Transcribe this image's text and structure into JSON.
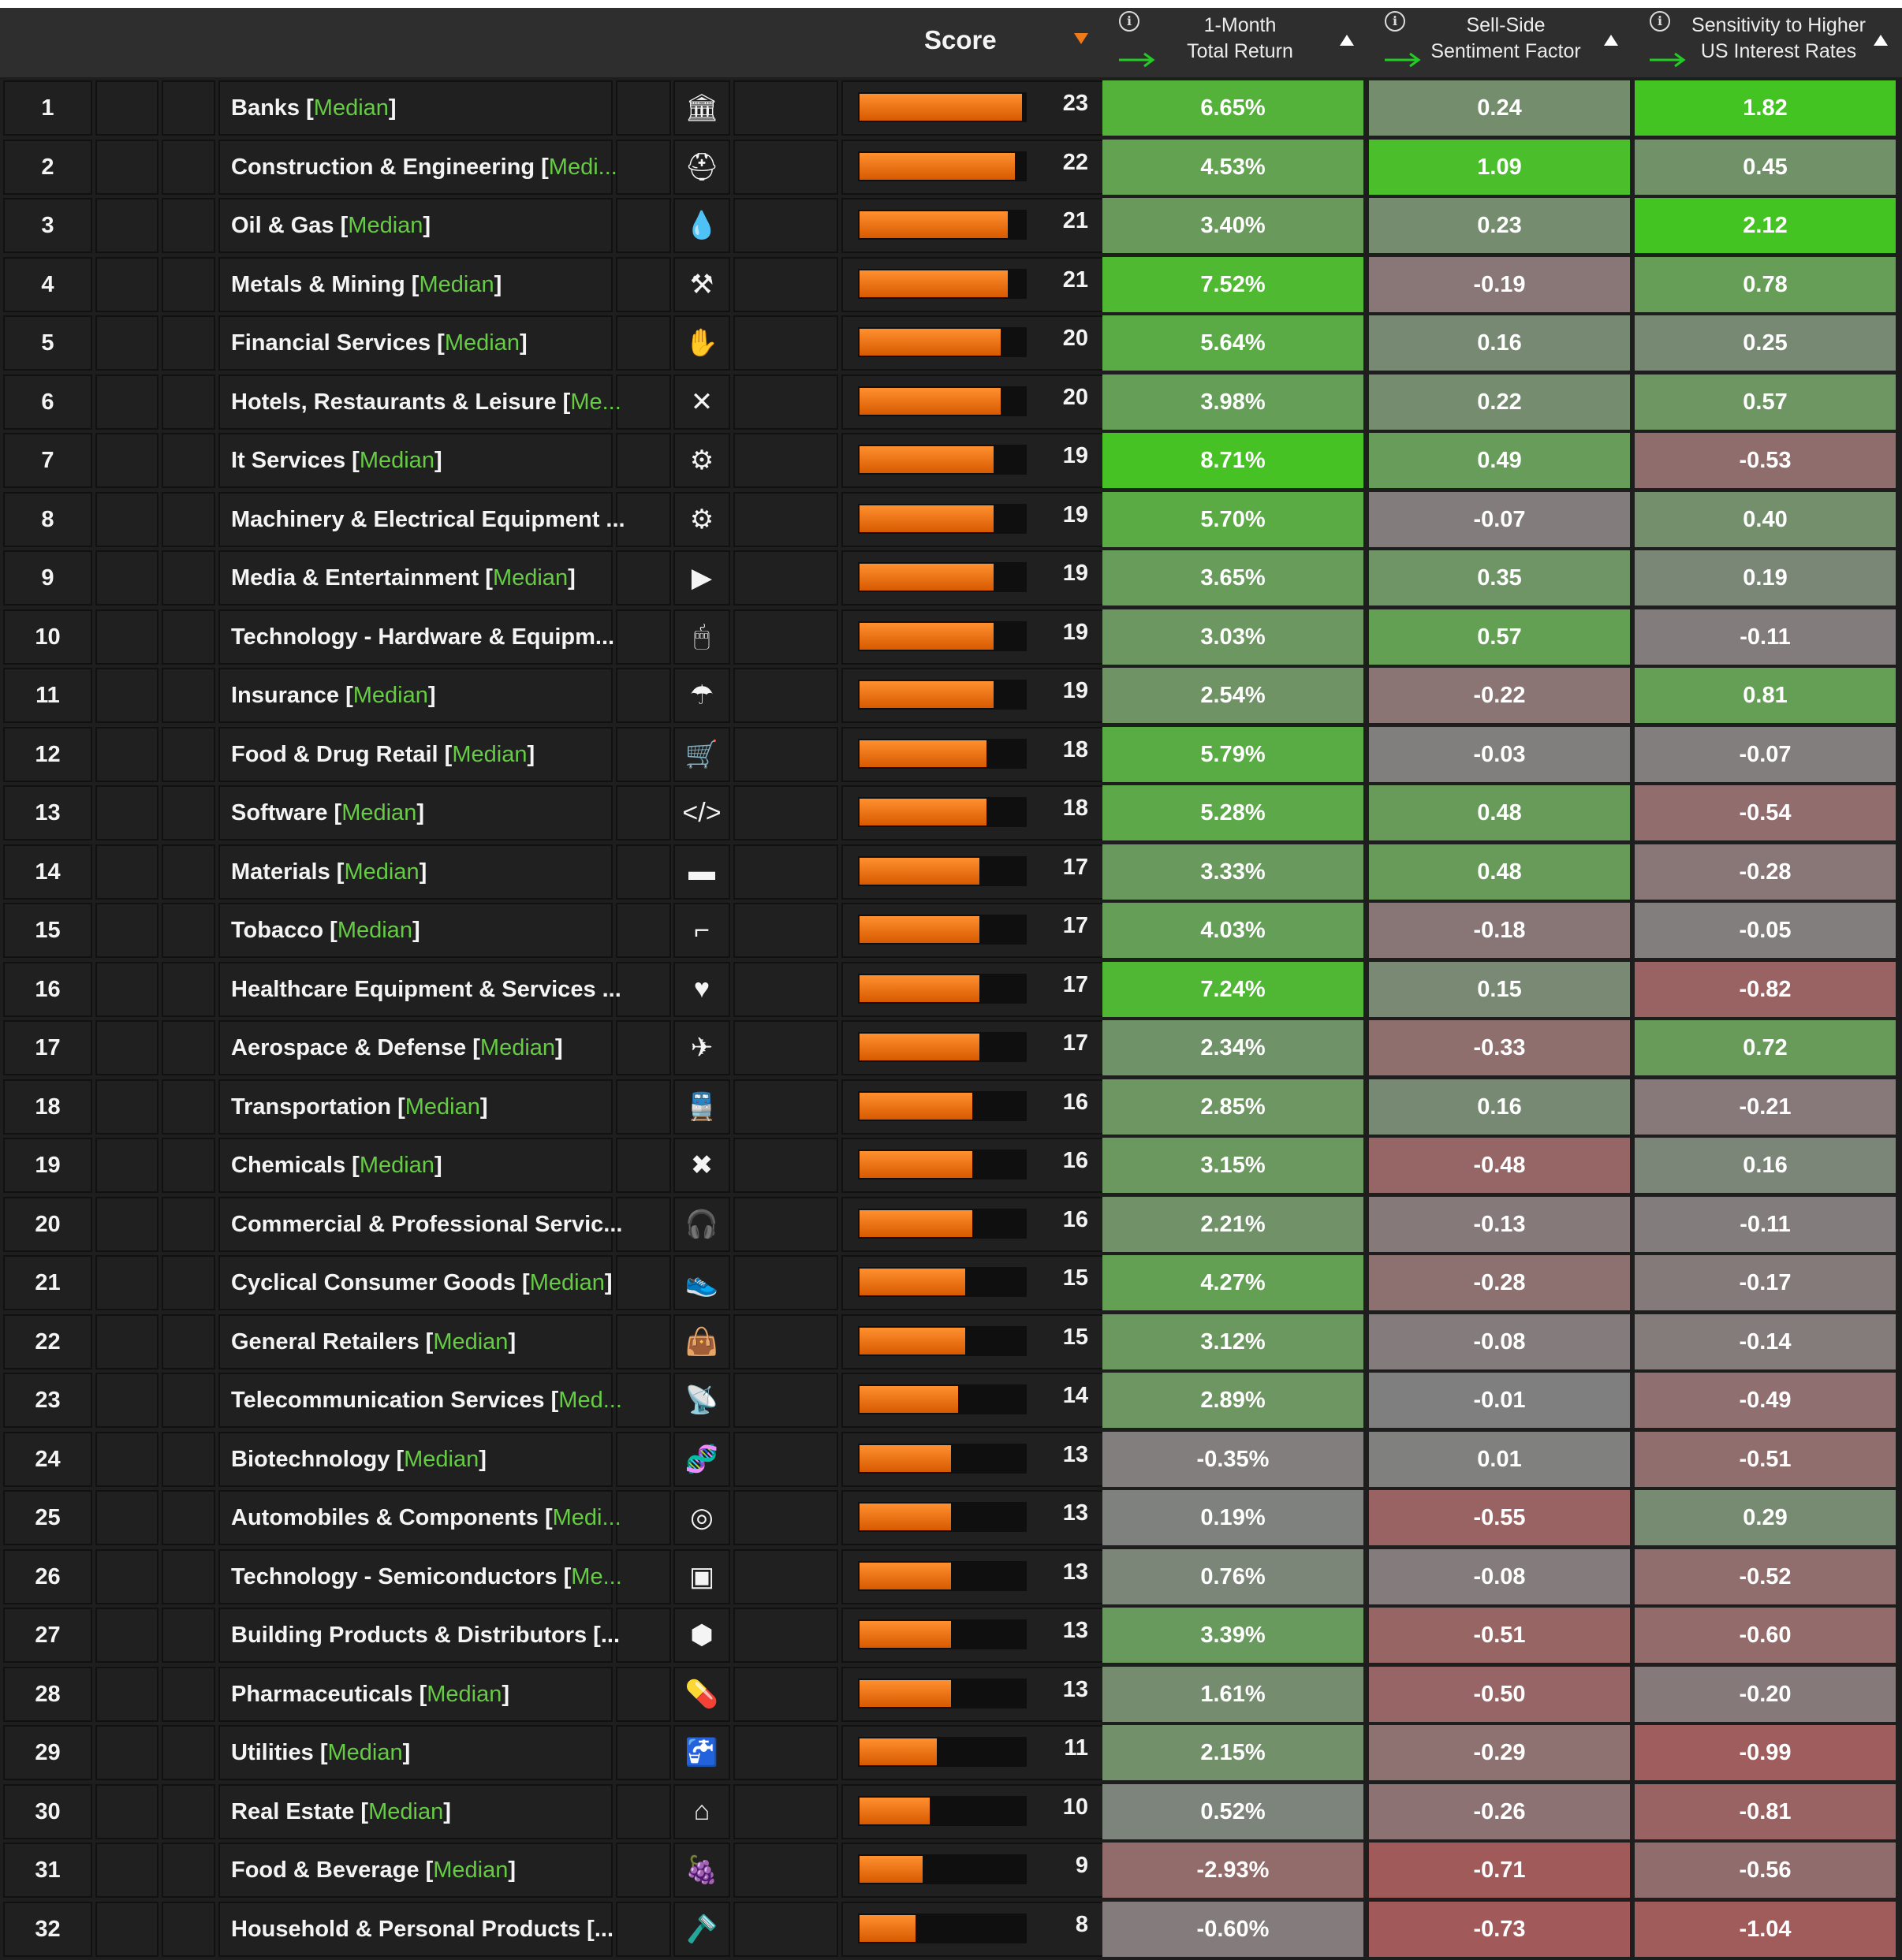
{
  "header": {
    "score_label": "Score",
    "columns": [
      {
        "line1": "1-Month",
        "line2": "Total Return"
      },
      {
        "line1": "Sell-Side",
        "line2": "Sentiment Factor"
      },
      {
        "line1": "Sensitivity to Higher",
        "line2": "US Interest Rates"
      }
    ],
    "info_icon": "info-circle-icon",
    "direction_icon": "green-arrow-right-icon"
  },
  "colors": {
    "bar": "#ee7a1a",
    "median_tag": "#66cc44",
    "positive": "#4ab82a",
    "neutral": "#808080",
    "negative": "#b84444"
  },
  "rows": [
    {
      "rank": "1",
      "name": "Banks ",
      "tag": "Median",
      "trunc": false,
      "icon": "bank-icon",
      "glyph": "🏛",
      "score": 23,
      "ret": "6.65%",
      "sent": "0.24",
      "rate": "1.82"
    },
    {
      "rank": "2",
      "name": "Construction & Engineering ",
      "tag": "Medi...",
      "trunc": true,
      "icon": "hard-hat-icon",
      "glyph": "⛑",
      "score": 22,
      "ret": "4.53%",
      "sent": "1.09",
      "rate": "0.45"
    },
    {
      "rank": "3",
      "name": "Oil & Gas ",
      "tag": "Median",
      "trunc": false,
      "icon": "oil-drop-icon",
      "glyph": "💧",
      "score": 21,
      "ret": "3.40%",
      "sent": "0.23",
      "rate": "2.12"
    },
    {
      "rank": "4",
      "name": "Metals & Mining ",
      "tag": "Median",
      "trunc": false,
      "icon": "pickaxe-icon",
      "glyph": "⚒",
      "score": 21,
      "ret": "7.52%",
      "sent": "-0.19",
      "rate": "0.78"
    },
    {
      "rank": "5",
      "name": "Financial Services ",
      "tag": "Median",
      "trunc": false,
      "icon": "hand-coins-icon",
      "glyph": "✋",
      "score": 20,
      "ret": "5.64%",
      "sent": "0.16",
      "rate": "0.25"
    },
    {
      "rank": "6",
      "name": "Hotels, Restaurants & Leisure ",
      "tag": "Me...",
      "trunc": true,
      "icon": "fork-knife-icon",
      "glyph": "✕",
      "score": 20,
      "ret": "3.98%",
      "sent": "0.22",
      "rate": "0.57"
    },
    {
      "rank": "7",
      "name": "It Services ",
      "tag": "Median",
      "trunc": false,
      "icon": "user-support-icon",
      "glyph": "⚙",
      "score": 19,
      "ret": "8.71%",
      "sent": "0.49",
      "rate": "-0.53"
    },
    {
      "rank": "8",
      "name": "Machinery & Electrical Equipment ...",
      "tag": "",
      "trunc": false,
      "icon": "gear-icon",
      "glyph": "⚙",
      "score": 19,
      "ret": "5.70%",
      "sent": "-0.07",
      "rate": "0.40"
    },
    {
      "rank": "9",
      "name": "Media & Entertainment ",
      "tag": "Median",
      "trunc": false,
      "icon": "play-circle-icon",
      "glyph": "▶",
      "score": 19,
      "ret": "3.65%",
      "sent": "0.35",
      "rate": "0.19"
    },
    {
      "rank": "10",
      "name": "Technology - Hardware & Equipm...",
      "tag": "",
      "trunc": false,
      "icon": "mouse-icon",
      "glyph": "🖱",
      "score": 19,
      "ret": "3.03%",
      "sent": "0.57",
      "rate": "-0.11"
    },
    {
      "rank": "11",
      "name": "Insurance ",
      "tag": "Median",
      "trunc": false,
      "icon": "umbrella-icon",
      "glyph": "☂",
      "score": 19,
      "ret": "2.54%",
      "sent": "-0.22",
      "rate": "0.81"
    },
    {
      "rank": "12",
      "name": "Food & Drug Retail ",
      "tag": "Median",
      "trunc": false,
      "icon": "shopping-cart-icon",
      "glyph": "🛒",
      "score": 18,
      "ret": "5.79%",
      "sent": "-0.03",
      "rate": "-0.07"
    },
    {
      "rank": "13",
      "name": "Software ",
      "tag": "Median",
      "trunc": false,
      "icon": "code-icon",
      "glyph": "</>",
      "score": 18,
      "ret": "5.28%",
      "sent": "0.48",
      "rate": "-0.54"
    },
    {
      "rank": "14",
      "name": "Materials ",
      "tag": "Median",
      "trunc": false,
      "icon": "materials-icon",
      "glyph": "▬",
      "score": 17,
      "ret": "3.33%",
      "sent": "0.48",
      "rate": "-0.28"
    },
    {
      "rank": "15",
      "name": "Tobacco ",
      "tag": "Median",
      "trunc": false,
      "icon": "pipe-icon",
      "glyph": "⌐",
      "score": 17,
      "ret": "4.03%",
      "sent": "-0.18",
      "rate": "-0.05"
    },
    {
      "rank": "16",
      "name": "Healthcare Equipment & Services ...",
      "tag": "",
      "trunc": false,
      "icon": "heart-plus-icon",
      "glyph": "♥",
      "score": 17,
      "ret": "7.24%",
      "sent": "0.15",
      "rate": "-0.82"
    },
    {
      "rank": "17",
      "name": "Aerospace & Defense ",
      "tag": "Median",
      "trunc": false,
      "icon": "airplane-icon",
      "glyph": "✈",
      "score": 17,
      "ret": "2.34%",
      "sent": "-0.33",
      "rate": "0.72"
    },
    {
      "rank": "18",
      "name": "Transportation ",
      "tag": "Median",
      "trunc": false,
      "icon": "train-icon",
      "glyph": "🚆",
      "score": 16,
      "ret": "2.85%",
      "sent": "0.16",
      "rate": "-0.21"
    },
    {
      "rank": "19",
      "name": "Chemicals ",
      "tag": "Median",
      "trunc": false,
      "icon": "chemicals-icon",
      "glyph": "✖",
      "score": 16,
      "ret": "3.15%",
      "sent": "-0.48",
      "rate": "0.16"
    },
    {
      "rank": "20",
      "name": "Commercial & Professional Servic...",
      "tag": "",
      "trunc": false,
      "icon": "headphones-icon",
      "glyph": "🎧",
      "score": 16,
      "ret": "2.21%",
      "sent": "-0.13",
      "rate": "-0.11"
    },
    {
      "rank": "21",
      "name": "Cyclical Consumer Goods ",
      "tag": "Median",
      "trunc": false,
      "icon": "shoe-icon",
      "glyph": "👟",
      "score": 15,
      "ret": "4.27%",
      "sent": "-0.28",
      "rate": "-0.17"
    },
    {
      "rank": "22",
      "name": "General Retailers ",
      "tag": "Median",
      "trunc": false,
      "icon": "shopping-bag-icon",
      "glyph": "👜",
      "score": 15,
      "ret": "3.12%",
      "sent": "-0.08",
      "rate": "-0.14"
    },
    {
      "rank": "23",
      "name": "Telecommunication Services ",
      "tag": "Med...",
      "trunc": true,
      "icon": "antenna-icon",
      "glyph": "📡",
      "score": 14,
      "ret": "2.89%",
      "sent": "-0.01",
      "rate": "-0.49"
    },
    {
      "rank": "24",
      "name": "Biotechnology ",
      "tag": "Median",
      "trunc": false,
      "icon": "dna-icon",
      "glyph": "🧬",
      "score": 13,
      "ret": "-0.35%",
      "sent": "0.01",
      "rate": "-0.51"
    },
    {
      "rank": "25",
      "name": "Automobiles & Components ",
      "tag": "Medi...",
      "trunc": true,
      "icon": "tire-icon",
      "glyph": "◎",
      "score": 13,
      "ret": "0.19%",
      "sent": "-0.55",
      "rate": "0.29"
    },
    {
      "rank": "26",
      "name": "Technology - Semiconductors ",
      "tag": "Me...",
      "trunc": true,
      "icon": "chip-icon",
      "glyph": "▣",
      "score": 13,
      "ret": "0.76%",
      "sent": "-0.08",
      "rate": "-0.52"
    },
    {
      "rank": "27",
      "name": "Building Products & Distributors [...",
      "tag": "",
      "trunc": false,
      "icon": "cube-icon",
      "glyph": "⬢",
      "score": 13,
      "ret": "3.39%",
      "sent": "-0.51",
      "rate": "-0.60"
    },
    {
      "rank": "28",
      "name": "Pharmaceuticals ",
      "tag": "Median",
      "trunc": false,
      "icon": "pill-icon",
      "glyph": "💊",
      "score": 13,
      "ret": "1.61%",
      "sent": "-0.50",
      "rate": "-0.20"
    },
    {
      "rank": "29",
      "name": "Utilities ",
      "tag": "Median",
      "trunc": false,
      "icon": "faucet-icon",
      "glyph": "🚰",
      "score": 11,
      "ret": "2.15%",
      "sent": "-0.29",
      "rate": "-0.99"
    },
    {
      "rank": "30",
      "name": "Real Estate ",
      "tag": "Median",
      "trunc": false,
      "icon": "house-icon",
      "glyph": "⌂",
      "score": 10,
      "ret": "0.52%",
      "sent": "-0.26",
      "rate": "-0.81"
    },
    {
      "rank": "31",
      "name": "Food & Beverage ",
      "tag": "Median",
      "trunc": false,
      "icon": "grapes-icon",
      "glyph": "🍇",
      "score": 9,
      "ret": "-2.93%",
      "sent": "-0.71",
      "rate": "-0.56"
    },
    {
      "rank": "32",
      "name": "Household & Personal Products [...",
      "tag": "",
      "trunc": false,
      "icon": "razor-icon",
      "glyph": "🪒",
      "score": 8,
      "ret": "-0.60%",
      "sent": "-0.73",
      "rate": "-1.04"
    }
  ]
}
